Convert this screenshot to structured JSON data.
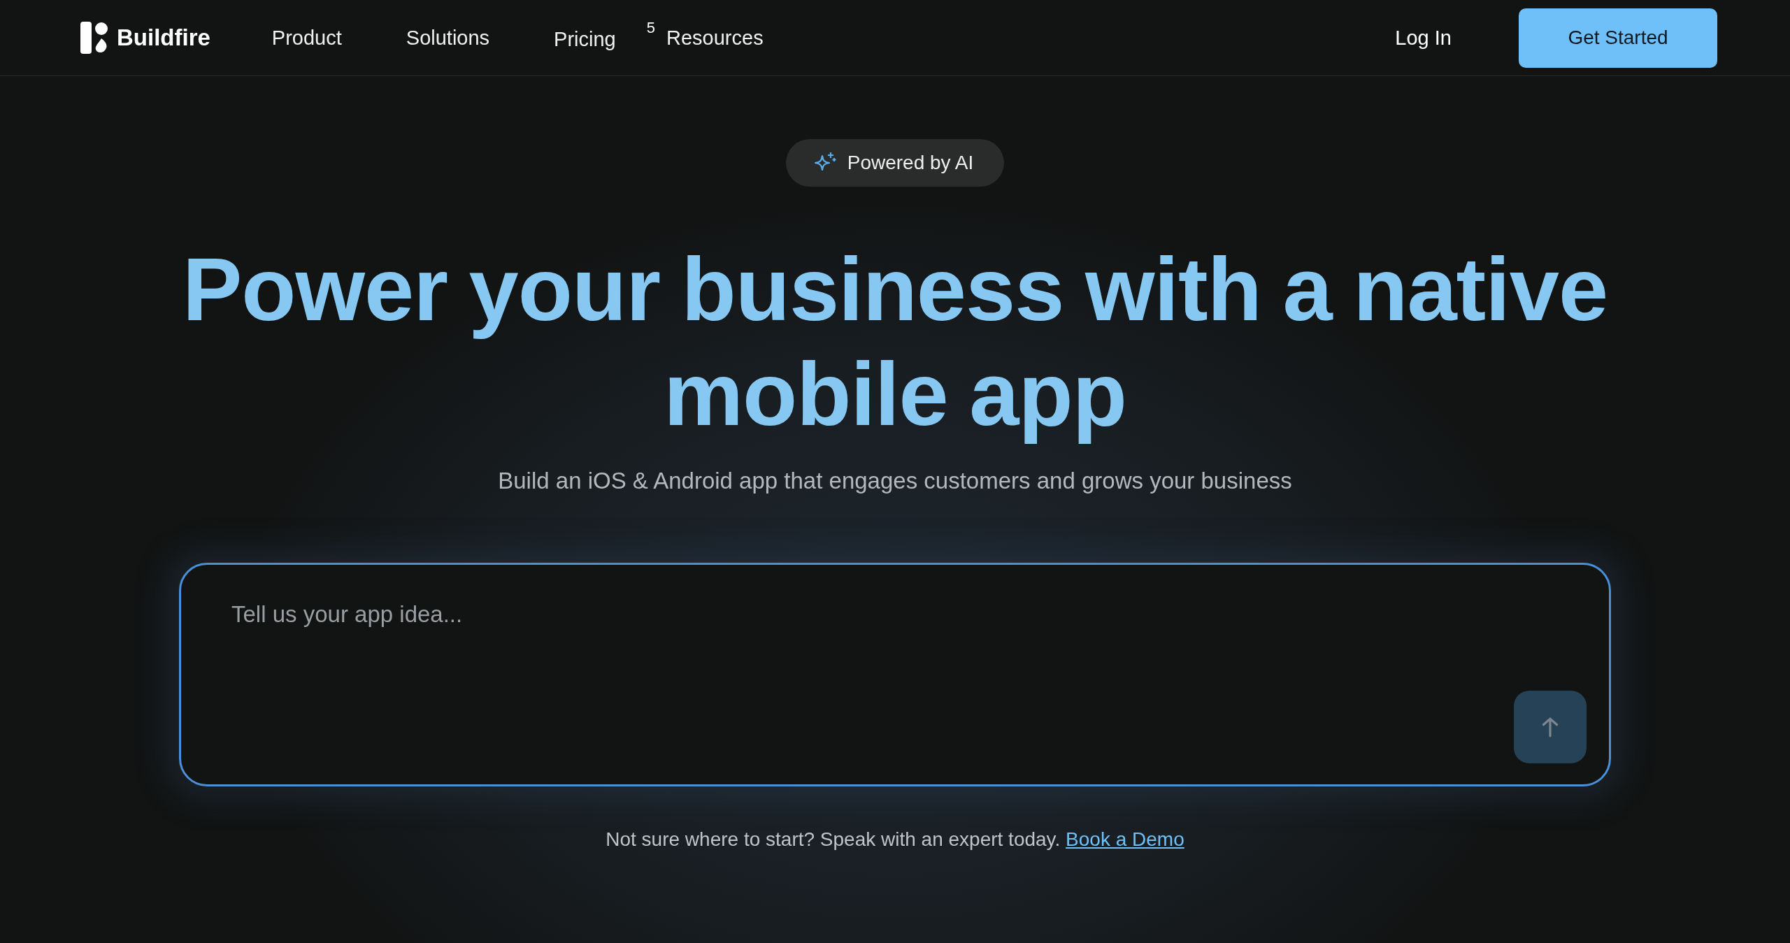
{
  "nav": {
    "brand": "Buildfire",
    "links": [
      {
        "label": "Product"
      },
      {
        "label": "Solutions"
      },
      {
        "label": "Pricing"
      },
      {
        "label": "Resources",
        "badge": "5"
      }
    ],
    "login": "Log In",
    "cta": "Get Started"
  },
  "hero": {
    "pill": "Powered by AI",
    "headline": "Power your business with a native mobile app",
    "subtitle": "Build an iOS & Android app that engages customers and grows your business"
  },
  "prompt": {
    "placeholder": "Tell us your app idea..."
  },
  "footer": {
    "text": "Not sure where to start? Speak with an expert today.",
    "link": "Book a Demo"
  }
}
